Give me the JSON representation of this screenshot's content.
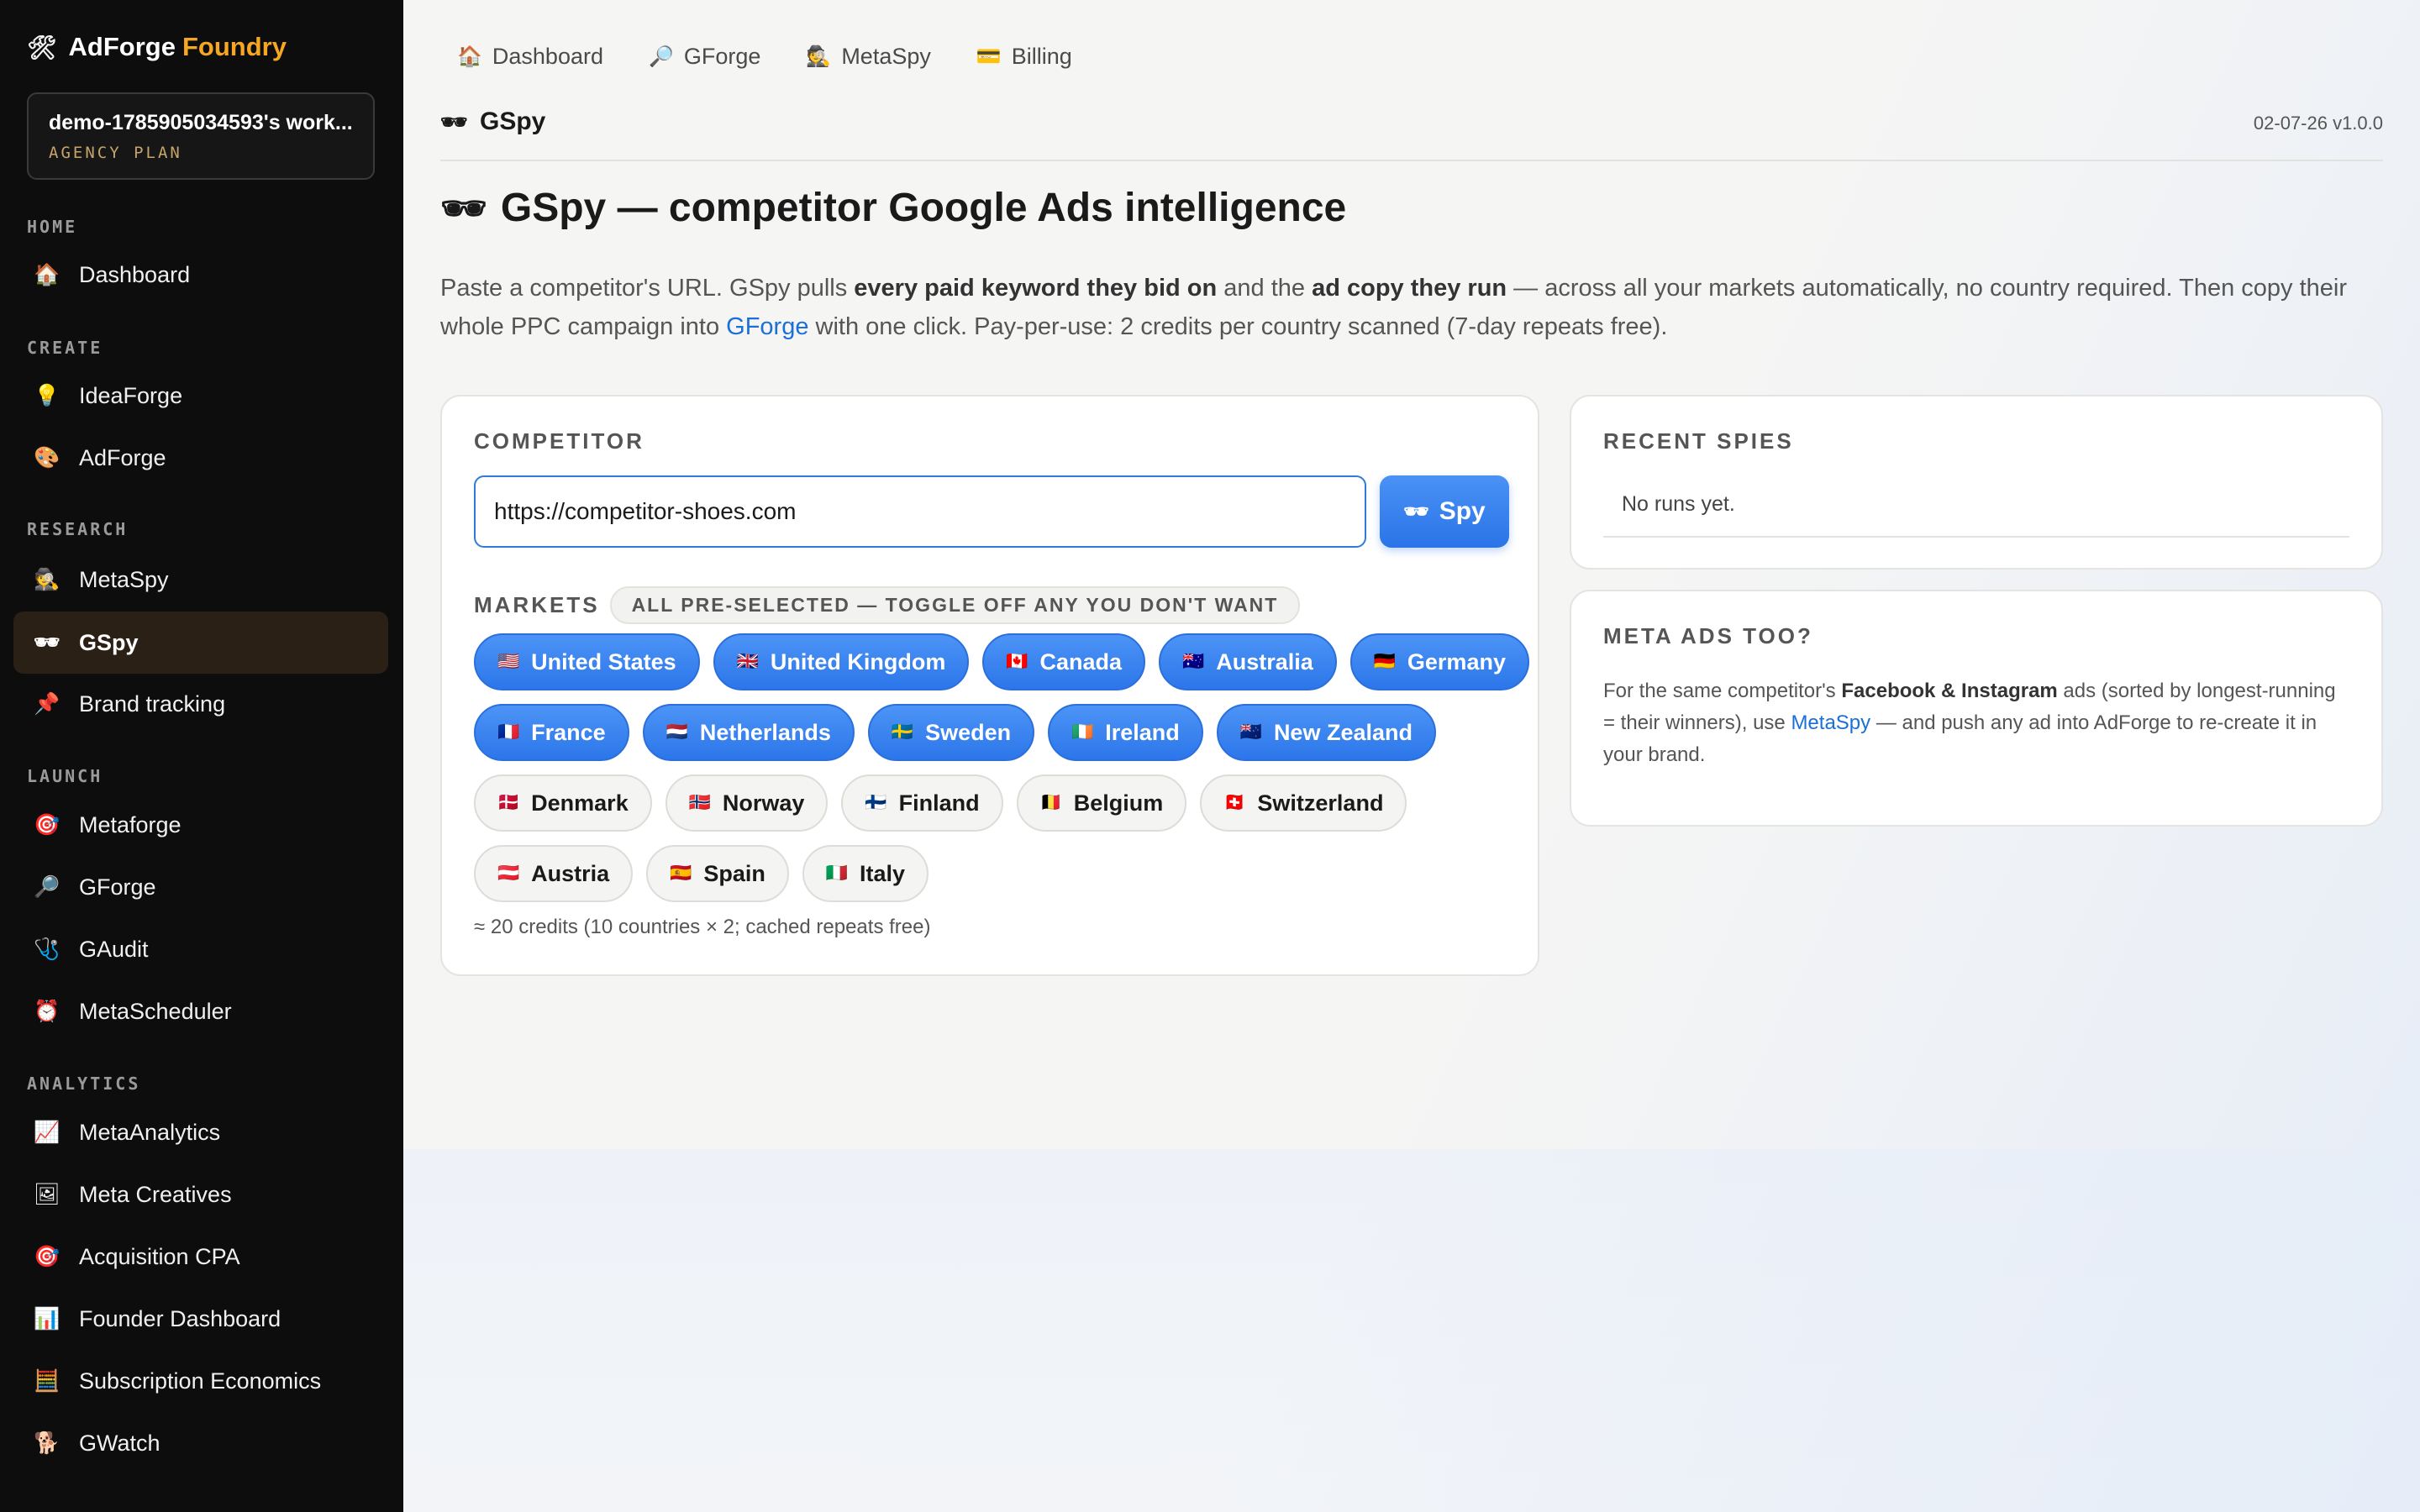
{
  "sidebar": {
    "brand_icon": "hammer-wrench-icon",
    "brand_name": "AdForge",
    "brand_accent": "Foundry",
    "workspace_name": "demo-1785905034593's work...",
    "workspace_plan": "AGENCY PLAN",
    "sections": {
      "home": "HOME",
      "create": "CREATE",
      "research": "RESEARCH",
      "launch": "LAUNCH",
      "analytics": "ANALYTICS"
    },
    "items": [
      {
        "id": "dashboard",
        "label": "Dashboard",
        "icon": "house-icon"
      },
      {
        "id": "ideaforge",
        "label": "IdeaForge",
        "icon": "lightbulb-icon"
      },
      {
        "id": "adforge",
        "label": "AdForge",
        "icon": "palette-icon"
      },
      {
        "id": "metaspy",
        "label": "MetaSpy",
        "icon": "detective-icon"
      },
      {
        "id": "gspy",
        "label": "GSpy",
        "icon": "sunglasses-icon",
        "active": true
      },
      {
        "id": "brand-tracking",
        "label": "Brand tracking",
        "icon": "pushpin-icon"
      },
      {
        "id": "metaforge",
        "label": "Metaforge",
        "icon": "target-icon"
      },
      {
        "id": "gforge",
        "label": "GForge",
        "icon": "magnifier-icon"
      },
      {
        "id": "gaudit",
        "label": "GAudit",
        "icon": "stethoscope-icon"
      },
      {
        "id": "metascheduler",
        "label": "MetaScheduler",
        "icon": "alarm-clock-icon"
      },
      {
        "id": "metaanalytics",
        "label": "MetaAnalytics",
        "icon": "chart-up-icon"
      },
      {
        "id": "meta-creatives",
        "label": "Meta Creatives",
        "icon": "framed-picture-icon"
      },
      {
        "id": "acquisition-cpa",
        "label": "Acquisition CPA",
        "icon": "target-icon"
      },
      {
        "id": "founder-dashboard",
        "label": "Founder Dashboard",
        "icon": "bar-chart-icon"
      },
      {
        "id": "subscription-economics",
        "label": "Subscription Economics",
        "icon": "abacus-icon"
      },
      {
        "id": "gwatch",
        "label": "GWatch",
        "icon": "dog-icon"
      }
    ]
  },
  "topnav": [
    {
      "label": "Dashboard",
      "icon": "house-icon"
    },
    {
      "label": "GForge",
      "icon": "magnifier-icon"
    },
    {
      "label": "MetaSpy",
      "icon": "detective-icon"
    },
    {
      "label": "Billing",
      "icon": "credit-card-icon"
    }
  ],
  "page": {
    "crumb_title": "GSpy",
    "version": "02-07-26 v1.0.0",
    "heading": "GSpy — competitor Google Ads intelligence",
    "intro_1": "Paste a competitor's URL. GSpy pulls ",
    "intro_b1": "every paid keyword they bid on",
    "intro_2": " and the ",
    "intro_b2": "ad copy they run",
    "intro_3": " — across all your markets automatically, no country required. Then copy their whole PPC campaign into ",
    "intro_link": "GForge",
    "intro_4": " with one click. Pay-per-use: 2 credits per country scanned (7-day repeats free)."
  },
  "competitor": {
    "label": "COMPETITOR",
    "url_value": "https://competitor-shoes.com",
    "spy_label": "Spy",
    "markets_label": "MARKETS",
    "markets_note": "ALL PRE-SELECTED — TOGGLE OFF ANY YOU DON'T WANT",
    "credits_note": "≈ 20 credits (10 countries × 2; cached repeats free)"
  },
  "markets": [
    {
      "name": "United States",
      "flag": "🇺🇸",
      "selected": true
    },
    {
      "name": "United Kingdom",
      "flag": "🇬🇧",
      "selected": true
    },
    {
      "name": "Canada",
      "flag": "🇨🇦",
      "selected": true
    },
    {
      "name": "Australia",
      "flag": "🇦🇺",
      "selected": true
    },
    {
      "name": "Germany",
      "flag": "🇩🇪",
      "selected": true
    },
    {
      "name": "France",
      "flag": "🇫🇷",
      "selected": true
    },
    {
      "name": "Netherlands",
      "flag": "🇳🇱",
      "selected": true
    },
    {
      "name": "Sweden",
      "flag": "🇸🇪",
      "selected": true
    },
    {
      "name": "Ireland",
      "flag": "🇮🇪",
      "selected": true
    },
    {
      "name": "New Zealand",
      "flag": "🇳🇿",
      "selected": true
    },
    {
      "name": "Denmark",
      "flag": "🇩🇰",
      "selected": false
    },
    {
      "name": "Norway",
      "flag": "🇳🇴",
      "selected": false
    },
    {
      "name": "Finland",
      "flag": "🇫🇮",
      "selected": false
    },
    {
      "name": "Belgium",
      "flag": "🇧🇪",
      "selected": false
    },
    {
      "name": "Switzerland",
      "flag": "🇨🇭",
      "selected": false
    },
    {
      "name": "Austria",
      "flag": "🇦🇹",
      "selected": false
    },
    {
      "name": "Spain",
      "flag": "🇪🇸",
      "selected": false
    },
    {
      "name": "Italy",
      "flag": "🇮🇹",
      "selected": false
    }
  ],
  "recent": {
    "label": "RECENT SPIES",
    "empty": "No runs yet."
  },
  "meta_ads": {
    "label": "META ADS TOO?",
    "t1": "For the same competitor's ",
    "b1": "Facebook & Instagram",
    "t2": " ads (sorted by longest-running = their winners), use ",
    "link": "MetaSpy",
    "t3": " — and push any ad into AdForge to re-create it in your brand."
  },
  "colors": {
    "accent": "#2a74e8",
    "brand_accent": "#f5a623",
    "sidebar_bg": "#0d0d0d",
    "active_item": "#2b2016",
    "link": "#1a6fd8"
  }
}
